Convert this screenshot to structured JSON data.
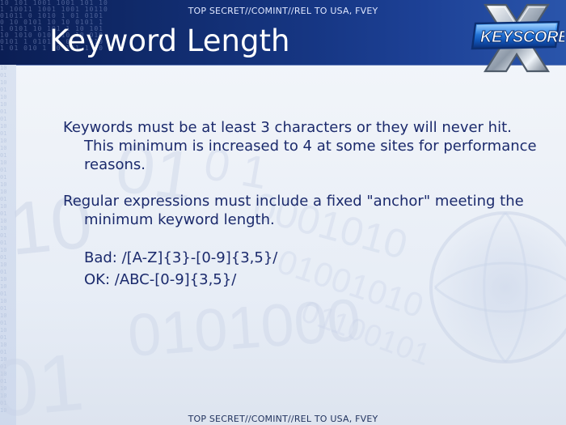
{
  "slide": {
    "classification_top": "TOP SECRET//COMINT//REL TO USA, FVEY",
    "title": "Keyword Length",
    "logo_text": "KEYSCORE",
    "bullets": [
      "Keywords must be at least 3 characters or they will never hit.  This minimum is increased to 4 at some sites for performance reasons.",
      "Regular expressions must include a fixed \"anchor\" meeting the minimum keyword length."
    ],
    "examples": [
      "Bad: /[A-Z]{3}-[0-9]{3,5}/",
      "OK: /ABC-[0-9]{3,5}/"
    ],
    "classification_bottom": "TOP SECRET//COMINT//REL TO USA, FVEY"
  },
  "colors": {
    "header_dark": "#0b1e54",
    "header_light": "#2a55ab",
    "text": "#1b2a6c",
    "background": "#eef2f8"
  }
}
